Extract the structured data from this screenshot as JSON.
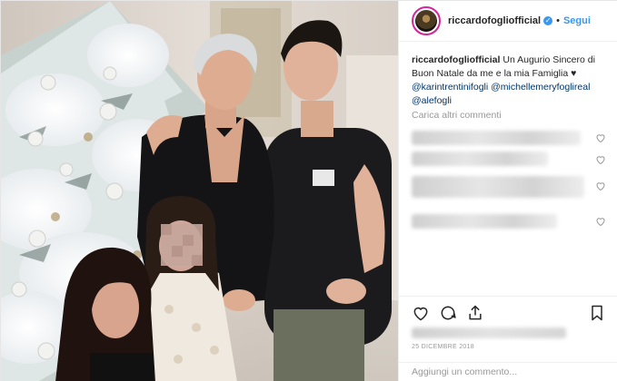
{
  "header": {
    "username": "riccardofogliofficial",
    "separator": "•",
    "follow_label": "Segui"
  },
  "caption": {
    "username": "riccardofogliofficial",
    "text": "Un Augurio Sincero di Buon Natale da me e la mia Famiglia ♥",
    "mentions": [
      "@karintrentinifogli",
      "@michellemeryfoglireal",
      "@alefogli"
    ]
  },
  "comments": {
    "load_more_label": "Carica altri commenti",
    "visible_count": 4
  },
  "post": {
    "date": "25 DICEMBRE 2018"
  },
  "add_comment": {
    "placeholder": "Aggiungi un commento..."
  },
  "icons": {
    "like": "heart-icon",
    "comment": "comment-icon",
    "share": "share-icon",
    "save": "bookmark-icon",
    "verified": "verified-badge-icon"
  },
  "colors": {
    "link_blue": "#3897f0",
    "mention_blue": "#003569",
    "muted_text": "#999999",
    "border": "#efefef"
  }
}
